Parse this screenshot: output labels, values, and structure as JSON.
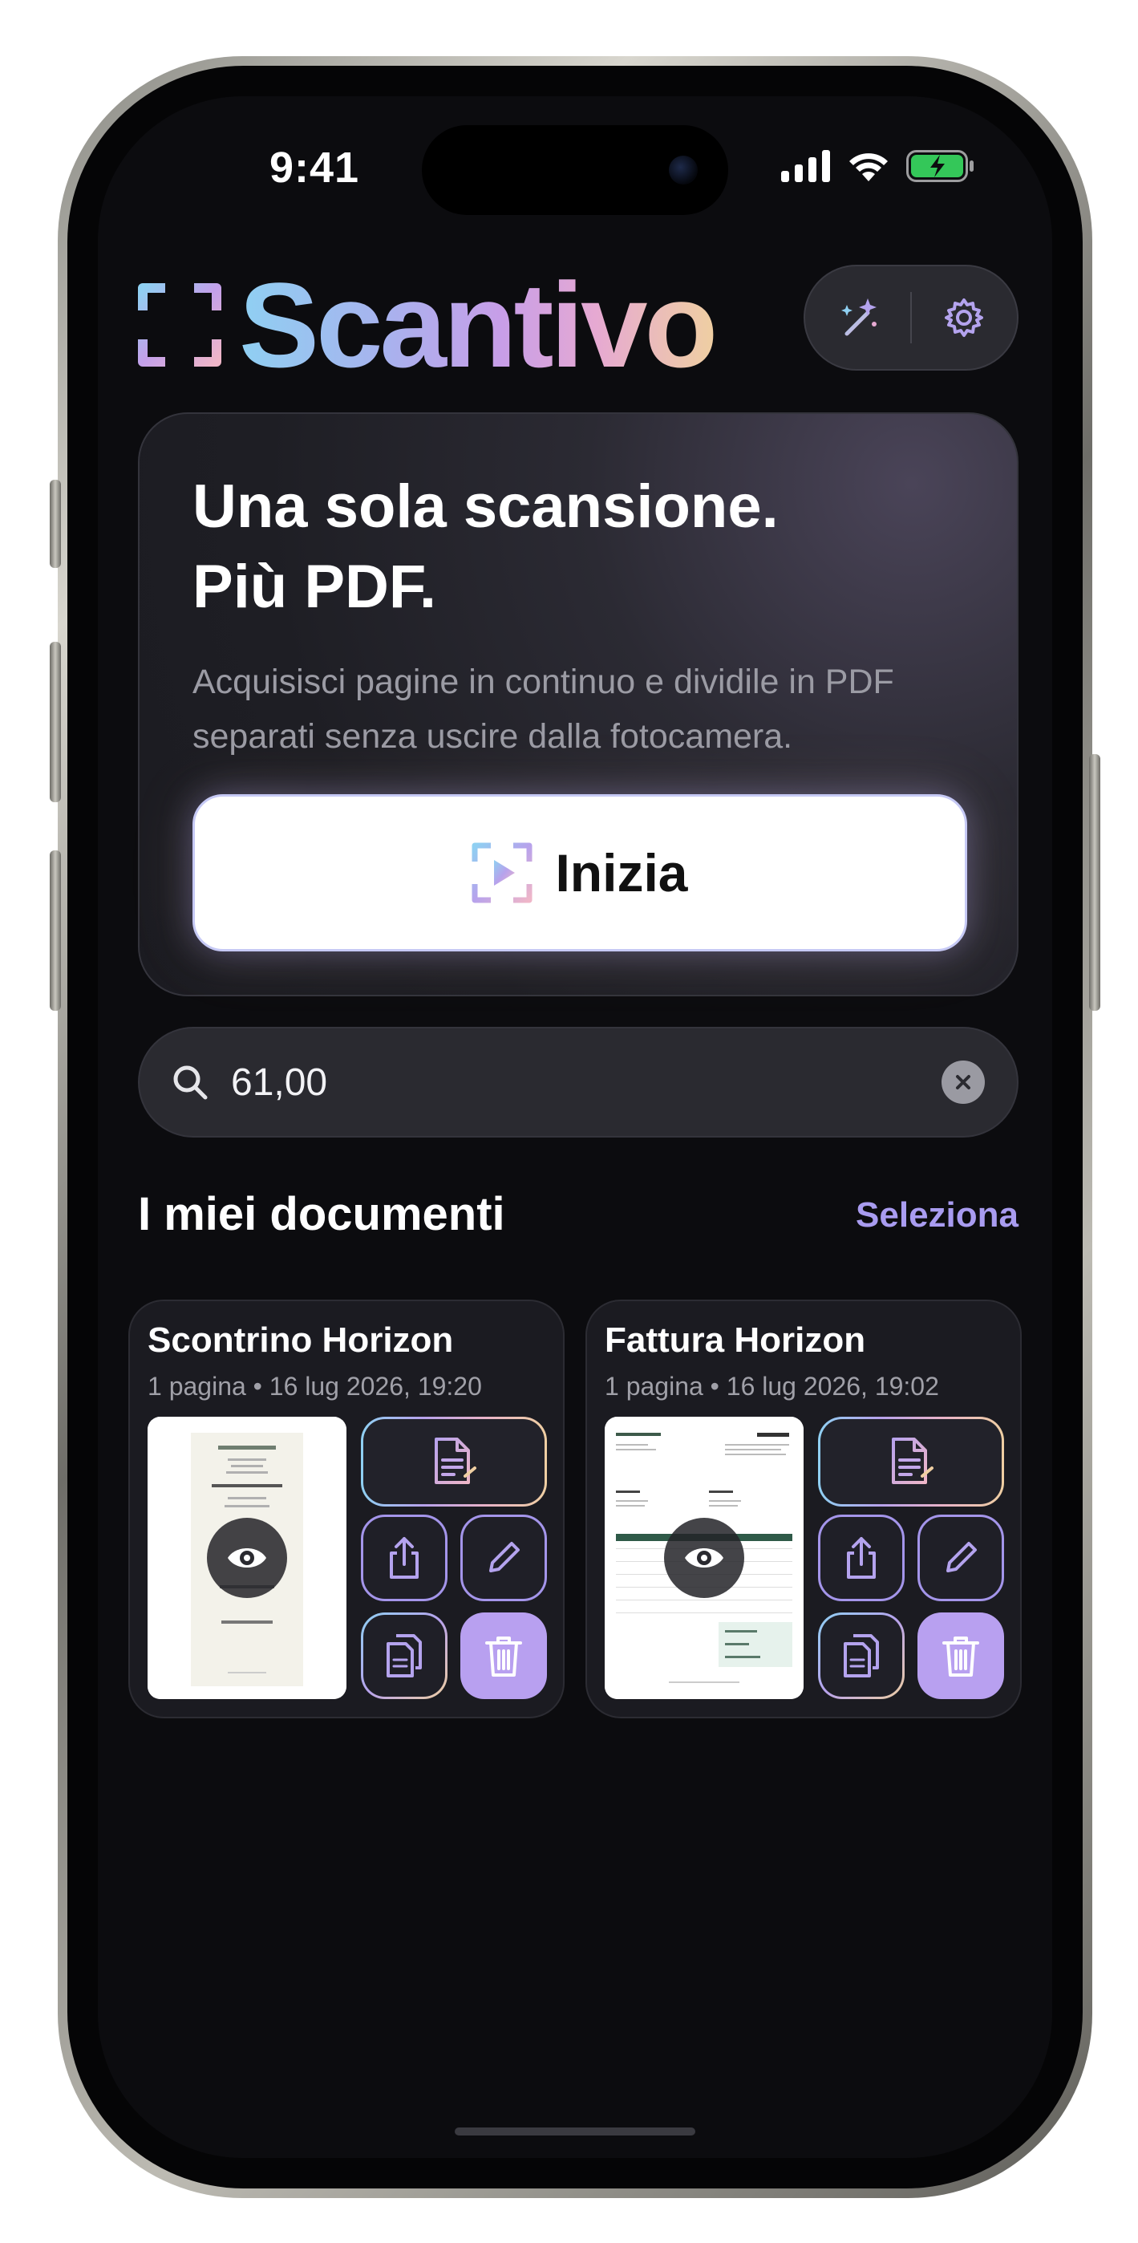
{
  "status_bar": {
    "time": "9:41"
  },
  "header": {
    "app_name": "Scantivo",
    "actions": [
      {
        "icon": "magic-wand-icon"
      },
      {
        "icon": "gear-icon"
      }
    ]
  },
  "hero": {
    "title_line1": "Una sola scansione.",
    "title_line2": "Più PDF.",
    "subtitle": "Acquisisci pagine in continuo e dividile in PDF separati senza uscire dalla fotocamera.",
    "button_label": "Inizia",
    "button_icon": "scan-play-icon"
  },
  "search": {
    "value": "61,00",
    "icon": "search-icon",
    "clear_icon": "close-icon"
  },
  "documents": {
    "section_title": "I miei documenti",
    "select_label": "Seleziona",
    "items": [
      {
        "title": "Scontrino Horizon",
        "meta": "1 pagina • 16 lug 2026, 19:20",
        "thumb_type": "receipt"
      },
      {
        "title": "Fattura Horizon",
        "meta": "1 pagina • 16 lug 2026, 19:02",
        "thumb_type": "invoice"
      }
    ]
  },
  "colors": {
    "accent": "#a99cf0",
    "trash_button": "#b8a0f0",
    "background": "#0c0c0f",
    "card": "#1b1b21"
  }
}
